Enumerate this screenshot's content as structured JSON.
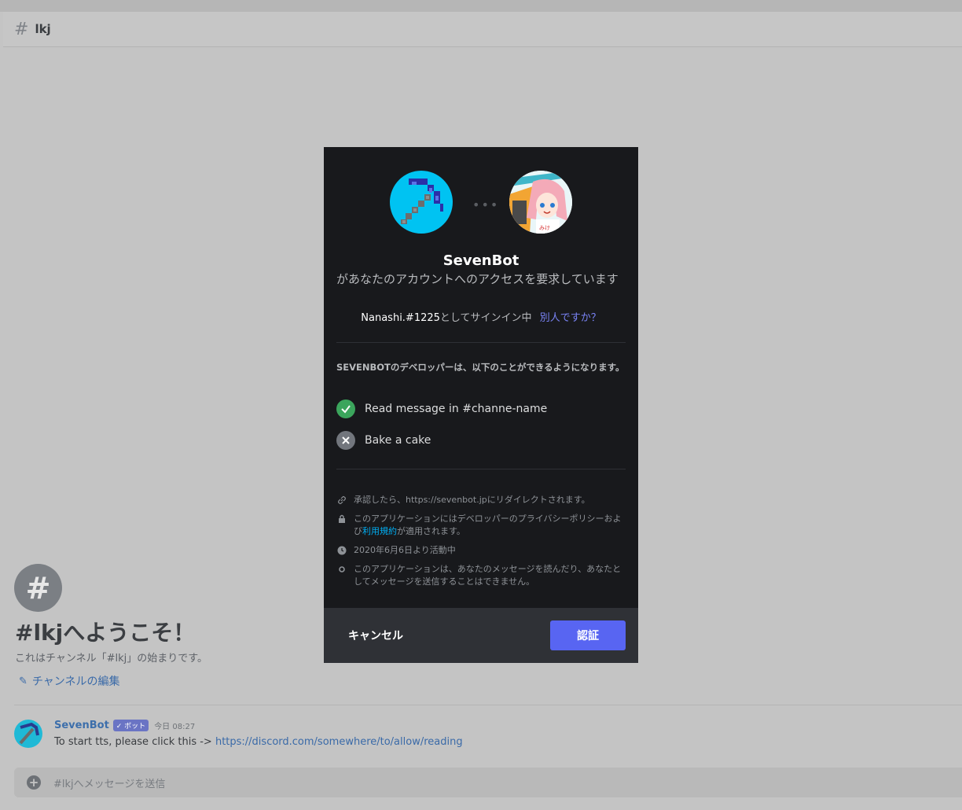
{
  "channel": {
    "name": "lkj",
    "hash_symbol": "#"
  },
  "welcome": {
    "title": "#lkjへようこそ！",
    "subtitle": "これはチャンネル「#lkj」の始まりです。",
    "edit_link": "チャンネルの編集"
  },
  "message": {
    "author": "SevenBot",
    "bot_tag": "✓ ボット",
    "time": "今日 08:27",
    "text": "To start tts, please click this -> ",
    "link": "https://discord.com/somewhere/to/allow/reading"
  },
  "composer": {
    "placeholder": "#lkjへメッセージを送信"
  },
  "modal": {
    "bot_name": "SevenBot",
    "request_text": "があなたのアカウントへのアクセスを要求しています",
    "signin": {
      "username": "Nanashi.#1225",
      "suffix": "としてサインイン中",
      "not_you": "別人ですか？"
    },
    "permissions_title": "SEVENBOTのデベロッパーは、以下のことができるようになります。",
    "permissions": [
      {
        "label": "Read message in #channe-name",
        "allowed": true
      },
      {
        "label": "Bake a cake",
        "allowed": false
      }
    ],
    "info": {
      "redirect": "承認したら、https://sevenbot.jpにリダイレクトされます。",
      "privacy_pre": "このアプリケーションにはデベロッパーのプライバシーポリシーおよび",
      "privacy_link": "利用規約",
      "privacy_post": "が適用されます。",
      "active_since": "2020年6月6日より活動中",
      "cannot": "このアプリケーションは、あなたのメッセージを読んだり、あなたとしてメッセージを送信することはできません。"
    },
    "buttons": {
      "cancel": "キャンセル",
      "authorize": "認証"
    }
  },
  "colors": {
    "accent": "#5865f2",
    "success": "#3ba55c",
    "link": "#00aff4",
    "modal_bg": "#18191c",
    "footer_bg": "#2f3136"
  }
}
